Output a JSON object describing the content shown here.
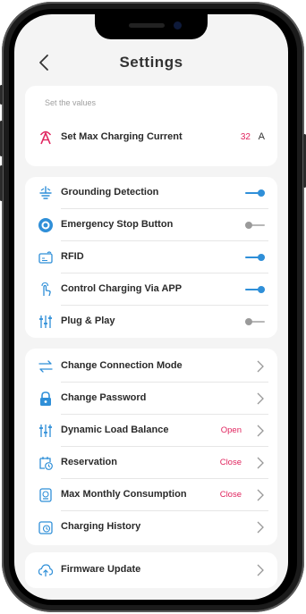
{
  "header": {
    "title": "Settings",
    "back_icon": "chevron-left-icon"
  },
  "colors": {
    "accent": "#2f8fd8",
    "danger": "#e0245e",
    "background": "#f4f4f4"
  },
  "current_section": {
    "hint": "Set the values",
    "max_current": {
      "label": "Set Max Charging Current",
      "value": "32",
      "unit": "A",
      "icon": "amp-icon"
    }
  },
  "toggles": [
    {
      "label": "Grounding Detection",
      "icon": "grounding-icon",
      "on": true
    },
    {
      "label": "Emergency Stop Button",
      "icon": "stop-button-icon",
      "on": false
    },
    {
      "label": "RFID",
      "icon": "rfid-icon",
      "on": true
    },
    {
      "label": "Control Charging Via APP",
      "icon": "hand-tap-icon",
      "on": true
    },
    {
      "label": "Plug & Play",
      "icon": "sliders-icon",
      "on": false
    }
  ],
  "links": [
    {
      "label": "Change Connection Mode",
      "icon": "swap-icon",
      "value": ""
    },
    {
      "label": "Change Password",
      "icon": "lock-icon",
      "value": ""
    },
    {
      "label": "Dynamic Load Balance",
      "icon": "sliders-icon",
      "value": "Open"
    },
    {
      "label": "Reservation",
      "icon": "calendar-clock-icon",
      "value": "Close"
    },
    {
      "label": "Max Monthly Consumption",
      "icon": "meter-icon",
      "value": "Close"
    },
    {
      "label": "Charging History",
      "icon": "history-icon",
      "value": ""
    }
  ],
  "firmware": {
    "label": "Firmware Update",
    "icon": "cloud-upload-icon"
  }
}
